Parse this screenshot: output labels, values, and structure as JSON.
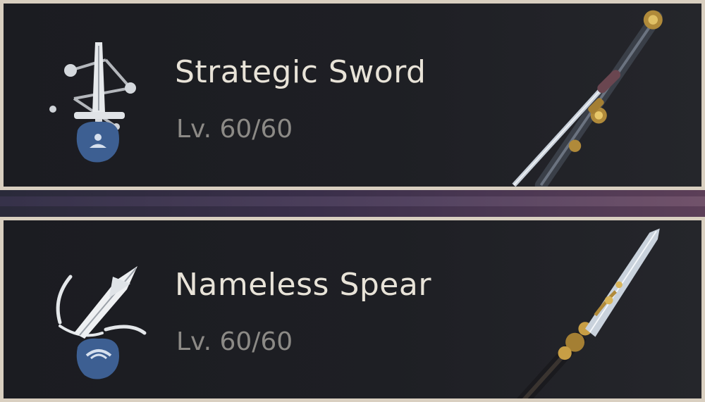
{
  "weapons": [
    {
      "name": "Strategic Sword",
      "level": "Lv. 60/60",
      "skill_icon": "sword-skill-icon",
      "art": "strategic-sword-art"
    },
    {
      "name": "Nameless Spear",
      "level": "Lv. 60/60",
      "skill_icon": "spear-skill-icon",
      "art": "nameless-spear-art"
    }
  ],
  "colors": {
    "frame": "#d9cfc0",
    "card_bg": "#1e1f24",
    "name_text": "#e8e3d8",
    "level_text": "#8c8a86",
    "badge_blue": "#3d5f92"
  }
}
